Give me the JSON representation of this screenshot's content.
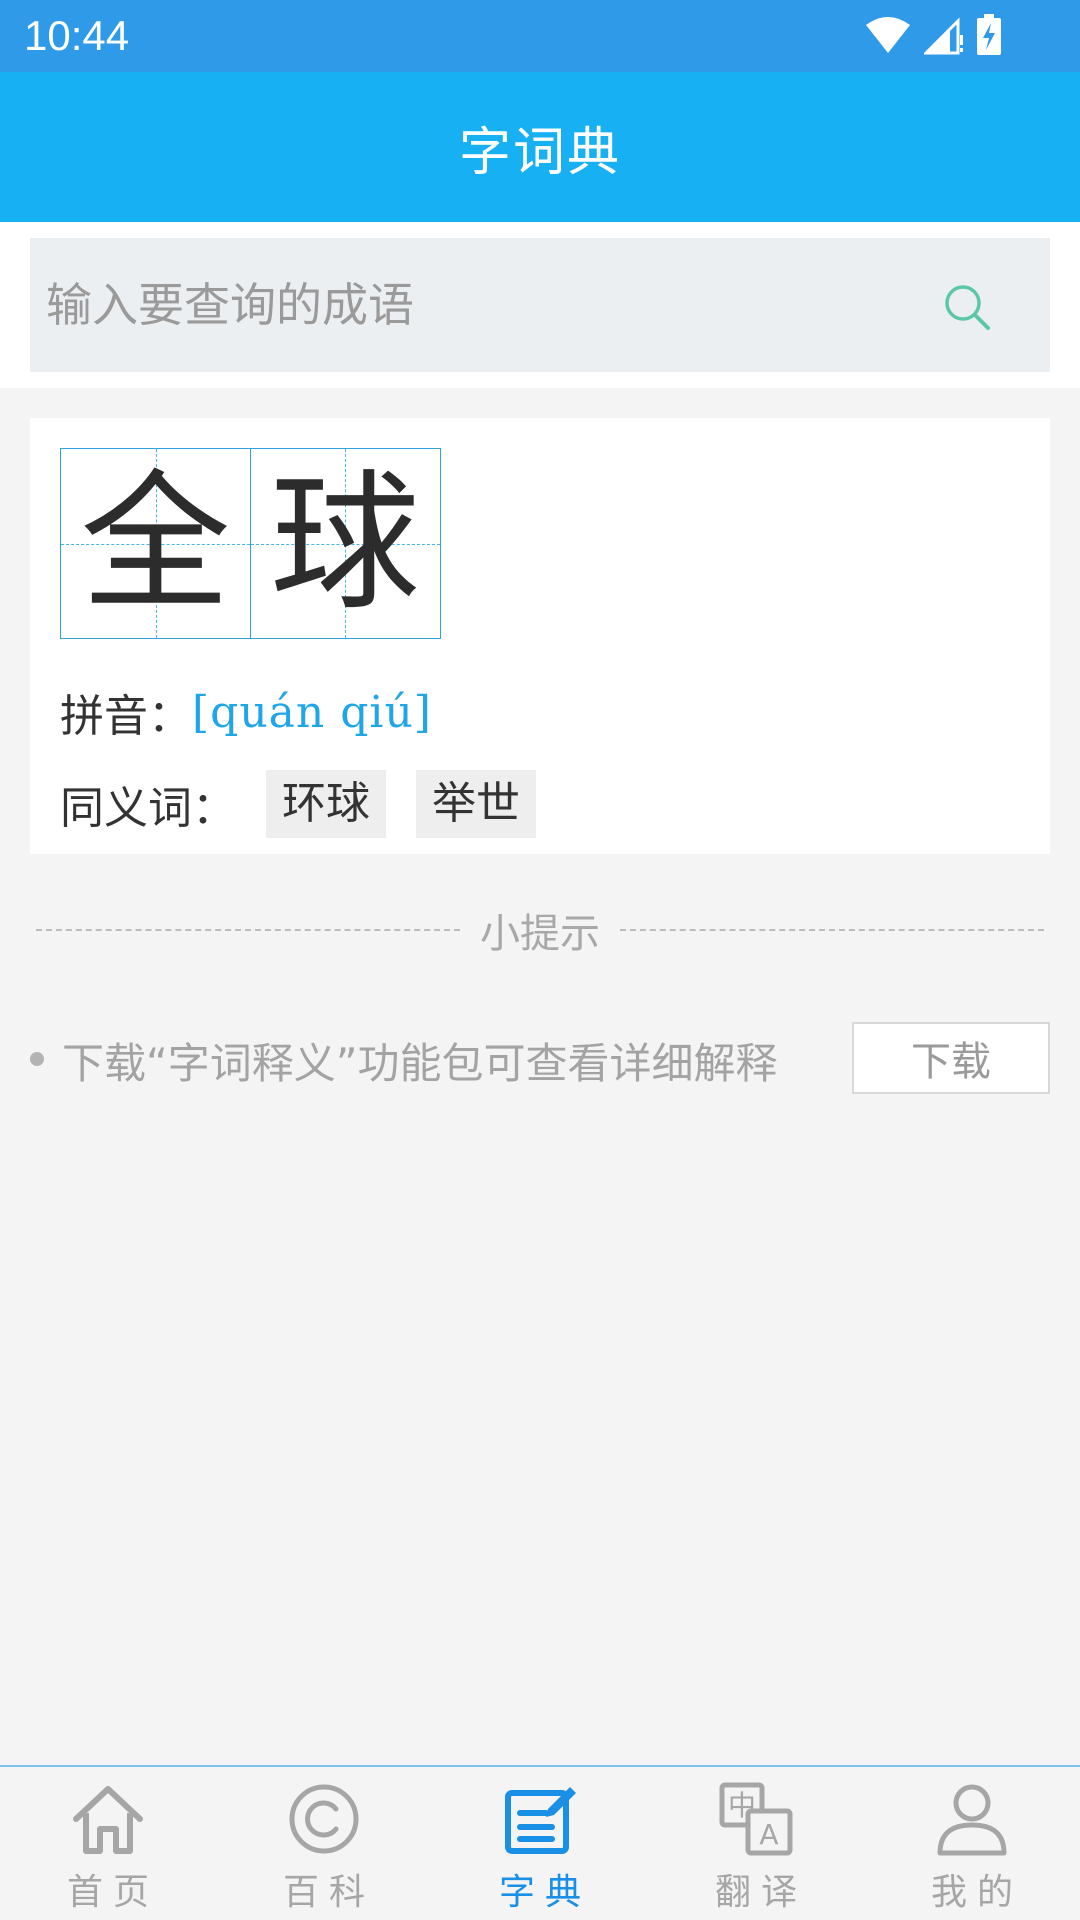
{
  "status_bar": {
    "time": "10:44",
    "icons": [
      "wifi-icon",
      "signal-icon",
      "battery-charging-icon"
    ]
  },
  "header": {
    "title": "字词典"
  },
  "search": {
    "placeholder": "输入要查询的成语",
    "value": "",
    "icon": "search-icon"
  },
  "word": {
    "characters": [
      "全",
      "球"
    ],
    "pinyin_label": "拼音：",
    "pinyin": "[quán qiú]",
    "synonyms_label": "同义词：",
    "synonyms": [
      "环球",
      "举世"
    ]
  },
  "tip": {
    "title": "小提示",
    "text": "下载“字词释义”功能包可查看详细解释",
    "button_label": "下载"
  },
  "bottom_nav": {
    "items": [
      {
        "label": "首页",
        "icon": "home-icon",
        "active": false
      },
      {
        "label": "百科",
        "icon": "copyright-icon",
        "active": false
      },
      {
        "label": "字典",
        "icon": "dictionary-icon",
        "active": true
      },
      {
        "label": "翻译",
        "icon": "translate-icon",
        "active": false
      },
      {
        "label": "我的",
        "icon": "user-icon",
        "active": false
      }
    ]
  },
  "colors": {
    "status_bar": "#2f9be8",
    "title_bar": "#17b0f2",
    "accent": "#1a8fe6",
    "grid_line": "#2fa3dd",
    "search_icon": "#5cc7a8"
  }
}
